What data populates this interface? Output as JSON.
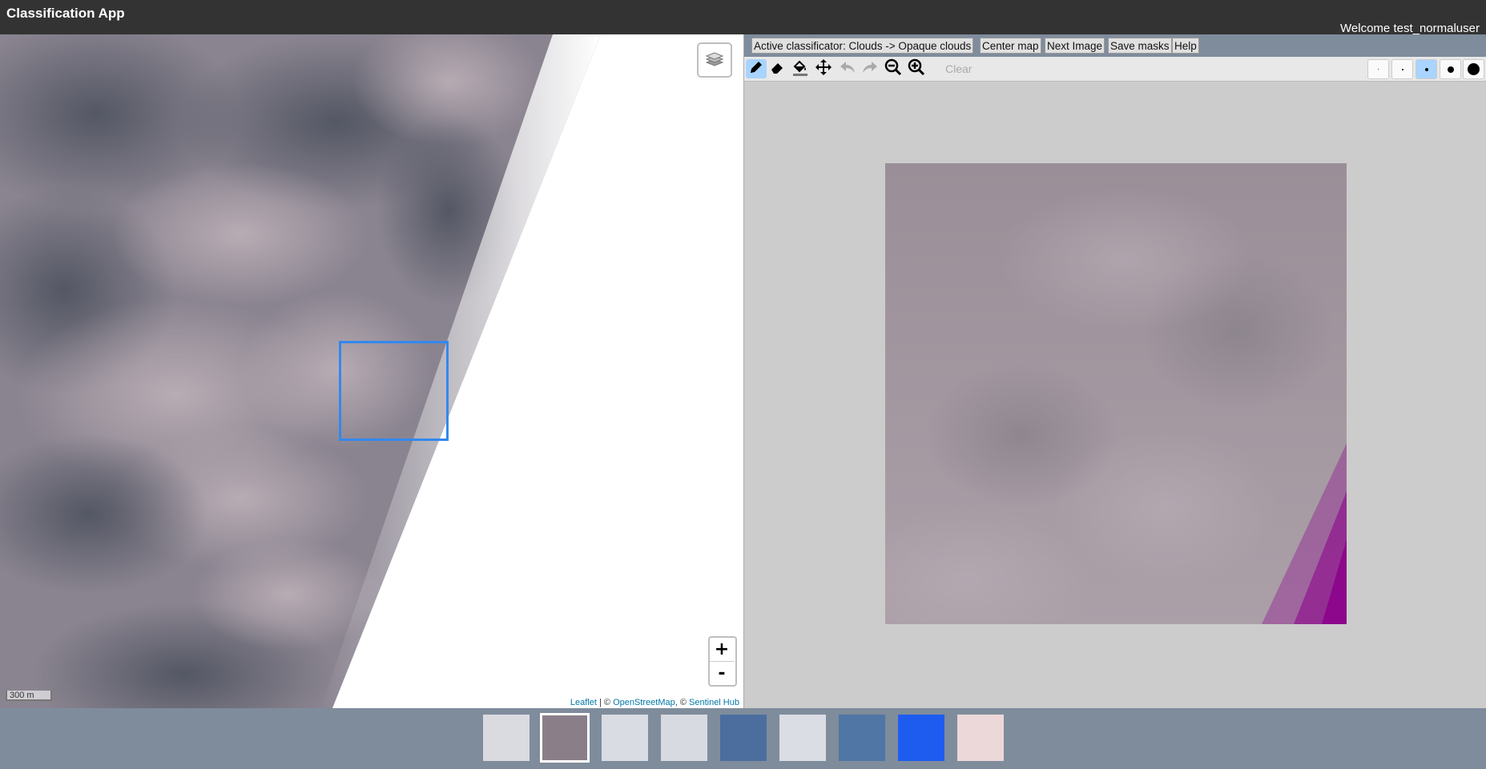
{
  "app": {
    "title": "Classification App",
    "welcome": "Welcome test_normaluser"
  },
  "map": {
    "scale_label": "300 m",
    "attribution": {
      "leaflet": "Leaflet",
      "sep1": " | © ",
      "osm": "OpenStreetMap",
      "sep2": ", © ",
      "sentinel": "Sentinel Hub"
    },
    "zoom_in": "+",
    "zoom_out": "-",
    "icons": [
      "layers-icon"
    ]
  },
  "editor": {
    "menu": {
      "classifier": "Active classificator: Clouds -> Opaque clouds",
      "center_map": "Center map",
      "next_image": "Next Image",
      "save_masks": "Save masks",
      "help": "Help"
    },
    "tools": [
      "pencil-icon",
      "eraser-icon",
      "fill-bucket-icon",
      "move-icon",
      "undo-icon",
      "redo-icon",
      "zoom-out-icon",
      "zoom-in-icon"
    ],
    "active_tool": "pencil-icon",
    "clear_label": "Clear",
    "brush_sizes": [
      "tiny",
      "small",
      "medium",
      "large",
      "xlarge"
    ],
    "active_brush": "medium",
    "mask_color": "#8b008b"
  },
  "thumbnails": {
    "count": 9,
    "selected_index": 1,
    "colors": [
      "#d9dbe1",
      "#8a7f88",
      "#d9dce3",
      "#d7dae1",
      "#4b6e9f",
      "#dadde4",
      "#4f76a4",
      "#1e5cf0",
      "#ecd8d8"
    ]
  }
}
